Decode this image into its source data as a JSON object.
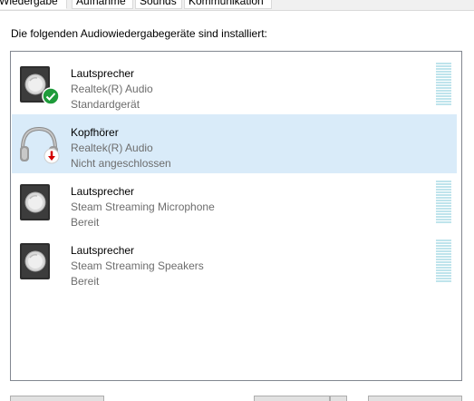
{
  "tabs": [
    {
      "label": "Wiedergabe",
      "active": true
    },
    {
      "label": "Aufnahme",
      "active": false
    },
    {
      "label": "Sounds",
      "active": false
    },
    {
      "label": "Kommunikation",
      "active": false
    }
  ],
  "instruction": "Die folgenden Audiowiedergabegeräte sind installiert:",
  "devices": [
    {
      "name": "Lautsprecher",
      "driver": "Realtek(R) Audio",
      "status": "Standardgerät",
      "icon": "speaker-icon",
      "badge": "default-check-icon",
      "selected": false
    },
    {
      "name": "Kopfhörer",
      "driver": "Realtek(R) Audio",
      "status": "Nicht angeschlossen",
      "icon": "headphones-icon",
      "badge": "disconnected-arrow-icon",
      "selected": true
    },
    {
      "name": "Lautsprecher",
      "driver": "Steam Streaming Microphone",
      "status": "Bereit",
      "icon": "speaker-icon",
      "badge": "",
      "selected": false
    },
    {
      "name": "Lautsprecher",
      "driver": "Steam Streaming Speakers",
      "status": "Bereit",
      "icon": "speaker-icon",
      "badge": "",
      "selected": false
    }
  ],
  "colors": {
    "selection": "#d9ebf9",
    "meter": "#bfe4ec",
    "check_badge": "#1e9b3a",
    "disconnect_arrow": "#d40000"
  }
}
